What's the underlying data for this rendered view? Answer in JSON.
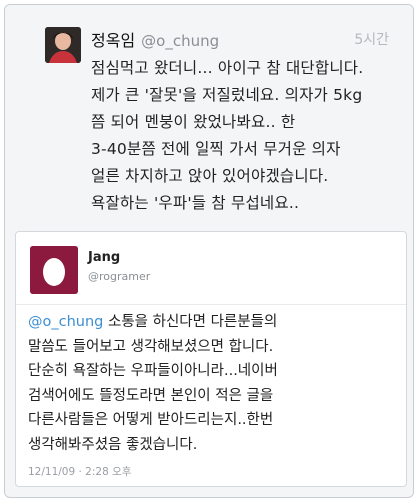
{
  "top_tweet": {
    "display_name": "정옥임",
    "handle": "@o_chung",
    "time": "5시간",
    "lines": [
      "점심먹고 왔더니... 아이구 참 대단합니다.",
      "제가 큰 '잘못'을 저질렀네요. 의자가 5kg",
      "쯤 되어 멘붕이 왔었나봐요.. 한",
      "3-40분쯤 전에 일찍 가서 무거운 의자",
      "얼른 차지하고 앉아 있어야겠습니다.",
      "욕잘하는 '우파'들 참 무섭네요.."
    ]
  },
  "reply": {
    "display_name": "Jang",
    "handle": "@rogramer",
    "mention": "@o_chung",
    "first_line_rest": " 소통을 하신다면 다른분들의",
    "lines": [
      "말씀도 들어보고 생각해보셨으면 합니다.",
      "단순히 욕잘하는 우파들이아니라...네이버",
      "검색어에도 뜰정도라면 본인이 적은 글을",
      "다른사람들은 어떻게 받아드리는지..한번",
      "생각해봐주셨음 좋겠습니다."
    ],
    "timestamp": "12/11/09 · 2:28 오후"
  }
}
